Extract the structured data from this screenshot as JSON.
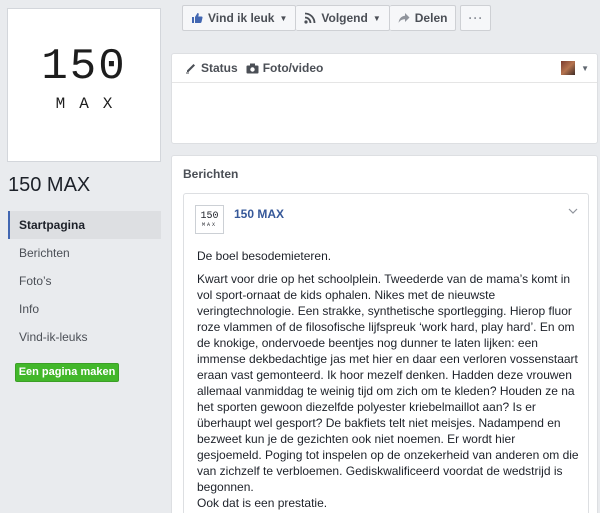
{
  "page": {
    "logo_number": "150",
    "logo_word": "MAX",
    "name": "150 MAX"
  },
  "nav": {
    "items": [
      {
        "label": "Startpagina"
      },
      {
        "label": "Berichten"
      },
      {
        "label": "Foto’s"
      },
      {
        "label": "Info"
      },
      {
        "label": "Vind-ik-leuks"
      }
    ],
    "create_page_label": "Een pagina maken"
  },
  "actions": {
    "like_label": "Vind ik leuk",
    "follow_label": "Volgend",
    "share_label": "Delen",
    "more_label": "···"
  },
  "composer": {
    "status_label": "Status",
    "photo_label": "Foto/video"
  },
  "posts": {
    "section_title": "Berichten",
    "post": {
      "avatar_number": "150",
      "avatar_word": "MAX",
      "author": "150 MAX",
      "paragraphs": [
        "De boel besodemieteren.",
        "Kwart voor drie op het schoolplein. Tweederde van de mama’s komt in vol sport-ornaat de kids ophalen. Nikes met de nieuwste veringtechnologie. Een strakke, synthetische sportlegging. Hierop fluor roze vlammen of de filosofische lijfspreuk ‘work hard, play hard’. En om de knokige, ondervoede beentjes nog dunner te laten lijken: een immense dekbedachtige jas met hier en daar een verloren vossenstaart eraan vast gemonteerd. Ik hoor mezelf denken. Hadden deze vrouwen allemaal vanmiddag te weinig tijd om zich om te kleden? Houden ze na het sporten gewoon diezelfde polyester kriebelmaillot aan? Is er überhaupt wel gesport? De bakfiets telt niet meisjes. Nadampend en bezweet kun je de gezichten ook niet noemen. Er wordt hier gesjoemeld. Poging tot inspelen op de onzekerheid van anderen om die van zichzelf te verbloemen. Gediskwalificeerd voordat de wedstrijd is begonnen.",
        "Ook dat is een prestatie."
      ]
    }
  },
  "colors": {
    "background": "#e9ebee",
    "link": "#365899",
    "accent": "#4267b2",
    "create_button": "#42b72a"
  }
}
